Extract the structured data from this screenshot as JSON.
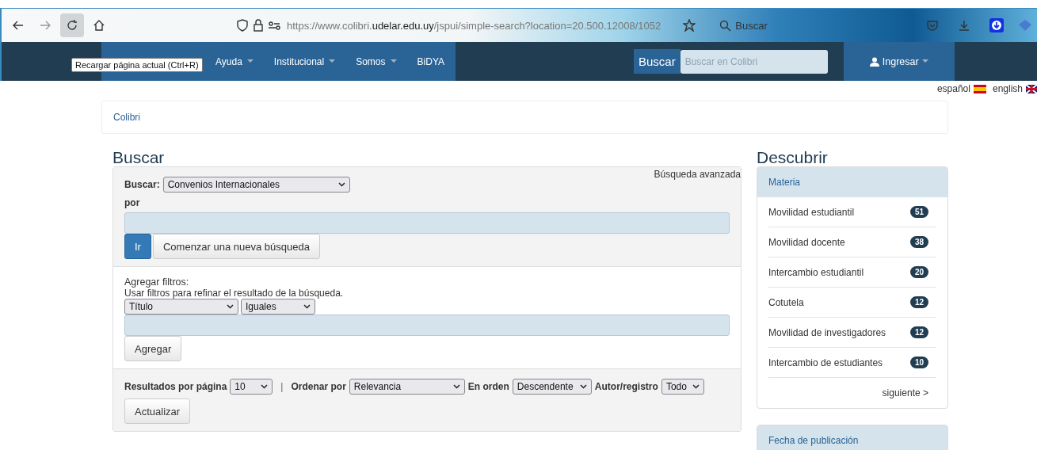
{
  "browser": {
    "url_prefix": "https://www.colibri.",
    "url_domain": "udelar.edu.uy",
    "url_suffix": "/jspui/simple-search?location=20.500.12008/1052",
    "search_label": "Buscar",
    "tooltip": "Recargar página actual (Ctrl+R)"
  },
  "nav": {
    "items": [
      {
        "label": "Ayuda",
        "dropdown": true
      },
      {
        "label": "Institucional",
        "dropdown": true
      },
      {
        "label": "Somos",
        "dropdown": true
      },
      {
        "label": "BiDYA",
        "dropdown": false
      }
    ],
    "search_label": "Buscar",
    "search_placeholder": "Buscar en Colibri",
    "login": "Ingresar"
  },
  "languages": [
    "español",
    "english"
  ],
  "breadcrumb": "Colibri",
  "search": {
    "title": "Buscar",
    "advanced": "Búsqueda avanzada",
    "scope_label": "Buscar:",
    "scope_value": "Convenios Internacionales",
    "por": "por",
    "go": "Ir",
    "new_search": "Comenzar una nueva búsqueda",
    "filters_title": "Agregar filtros:",
    "filters_hint": "Usar filtros para refinar el resultado de la búsqueda.",
    "filter_field": "Título",
    "filter_op": "Iguales",
    "add": "Agregar",
    "options": [
      {
        "label": "Resultados por página",
        "value": "10",
        "kind": "small"
      },
      {
        "label": "Ordenar por",
        "value": "Relevancia",
        "kind": "wide"
      },
      {
        "label": "En orden",
        "value": "Descendente",
        "kind": "medium"
      },
      {
        "label": "Autor/registro",
        "value": "Todo",
        "kind": "small"
      }
    ],
    "separator": "|",
    "update": "Actualizar"
  },
  "discover": {
    "title": "Descubrir",
    "facets": [
      {
        "title": "Materia",
        "items": [
          {
            "label": "Movilidad estudiantil",
            "count": "51"
          },
          {
            "label": "Movilidad docente",
            "count": "38"
          },
          {
            "label": "Intercambio estudiantil",
            "count": "20"
          },
          {
            "label": "Cotutela",
            "count": "12"
          },
          {
            "label": "Movilidad de investigadores",
            "count": "12"
          },
          {
            "label": "Intercambio de estudiantes",
            "count": "10"
          }
        ],
        "next": "siguiente >"
      },
      {
        "title": "Fecha de publicación"
      }
    ]
  }
}
